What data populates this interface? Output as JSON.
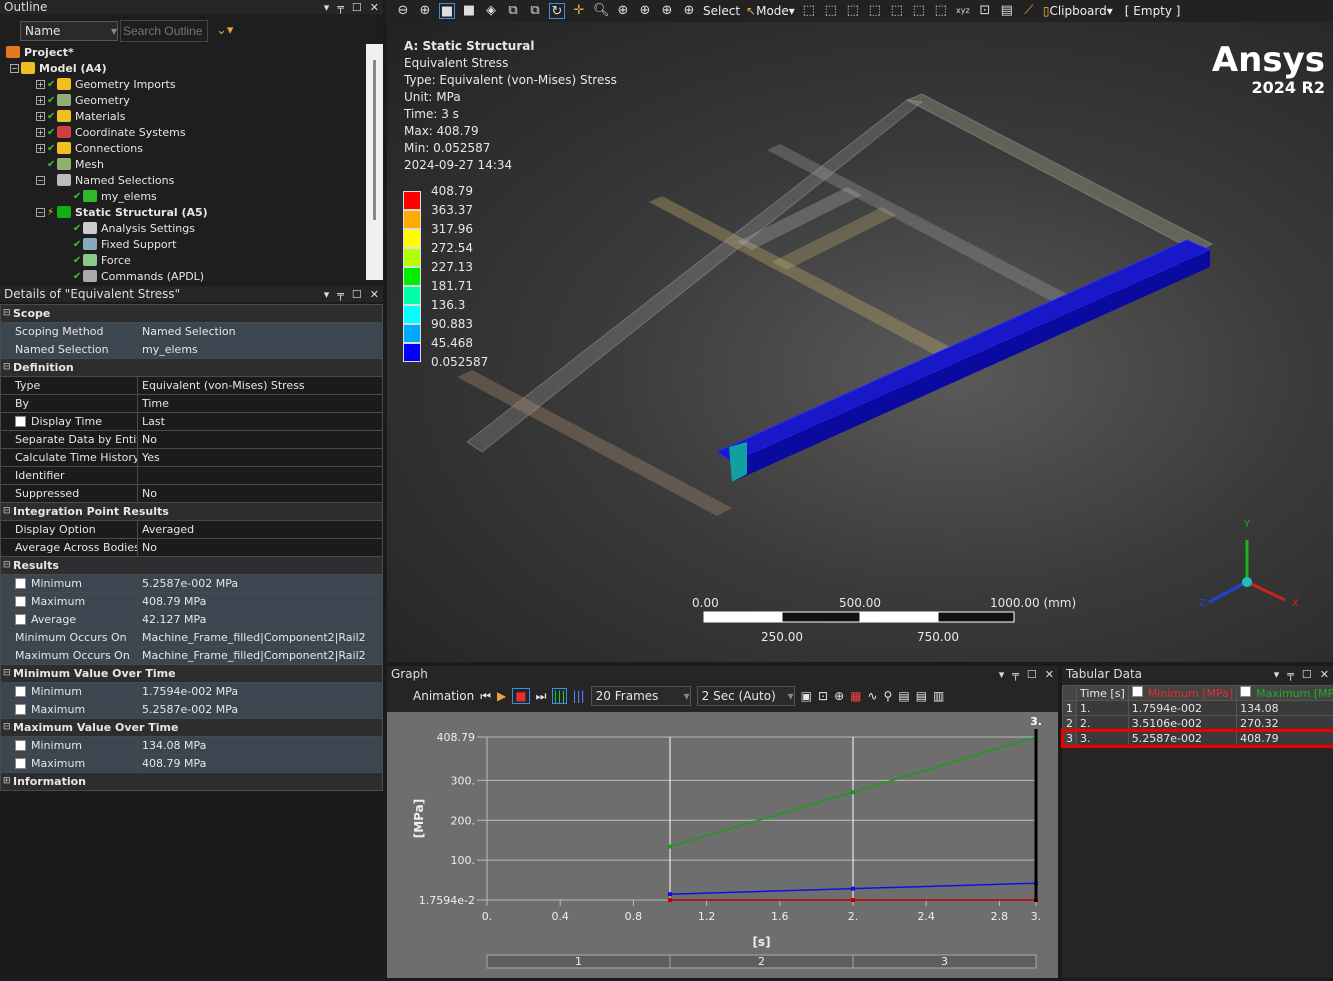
{
  "outline": {
    "title": "Outline",
    "filter_label": "Name",
    "search_placeholder": "Search Outline",
    "items": [
      {
        "label": "Project*",
        "level": 0,
        "bold": true,
        "icon": "project-icon",
        "color": "#e07b20"
      },
      {
        "label": "Model (A4)",
        "level": 1,
        "bold": true,
        "icon": "model-folder-icon",
        "color": "#f0c020",
        "exp": "-"
      },
      {
        "label": "Geometry Imports",
        "level": 2,
        "icon": "geometry-imports-icon",
        "color": "#f0c020",
        "exp": "+",
        "check": true
      },
      {
        "label": "Geometry",
        "level": 2,
        "icon": "geometry-icon",
        "color": "#8fae6f",
        "exp": "+",
        "check": true
      },
      {
        "label": "Materials",
        "level": 2,
        "icon": "materials-icon",
        "color": "#f0c020",
        "exp": "+",
        "check": true
      },
      {
        "label": "Coordinate Systems",
        "level": 2,
        "icon": "coordinate-systems-icon",
        "color": "#d04040",
        "exp": "+",
        "check": true
      },
      {
        "label": "Connections",
        "level": 2,
        "icon": "connections-icon",
        "color": "#f0c020",
        "exp": "+",
        "check": true
      },
      {
        "label": "Mesh",
        "level": 2,
        "icon": "mesh-icon",
        "color": "#8fae6f",
        "check": true
      },
      {
        "label": "Named Selections",
        "level": 2,
        "icon": "named-selections-icon",
        "color": "#bbb",
        "exp": "-"
      },
      {
        "label": "my_elems",
        "level": 3,
        "icon": "named-selection-item-icon",
        "color": "#2db82d",
        "check": true
      },
      {
        "label": "Static Structural (A5)",
        "level": 2,
        "bold": true,
        "icon": "static-structural-icon",
        "color": "#10b010",
        "exp": "-",
        "bolt": true
      },
      {
        "label": "Analysis Settings",
        "level": 3,
        "icon": "analysis-settings-icon",
        "color": "#ccc",
        "check": true
      },
      {
        "label": "Fixed Support",
        "level": 3,
        "icon": "fixed-support-icon",
        "color": "#8ab",
        "check": true
      },
      {
        "label": "Force",
        "level": 3,
        "icon": "force-icon",
        "color": "#8c8",
        "check": true
      },
      {
        "label": "Commands (APDL)",
        "level": 3,
        "icon": "commands-icon",
        "color": "#aaa",
        "check": true
      }
    ]
  },
  "details": {
    "title": "Details of \"Equivalent Stress\"",
    "rows": [
      {
        "g": "Scope"
      },
      {
        "k": "Scoping Method",
        "v": "Named Selection",
        "hl": true
      },
      {
        "k": "Named Selection",
        "v": "my_elems",
        "hl": true
      },
      {
        "g": "Definition"
      },
      {
        "k": "Type",
        "v": "Equivalent (von-Mises) Stress"
      },
      {
        "k": "By",
        "v": "Time"
      },
      {
        "k": "Display Time",
        "v": "Last",
        "cb": true
      },
      {
        "k": "Separate Data by Entity",
        "v": "No"
      },
      {
        "k": "Calculate Time History",
        "v": "Yes"
      },
      {
        "k": "Identifier",
        "v": ""
      },
      {
        "k": "Suppressed",
        "v": "No"
      },
      {
        "g": "Integration Point Results"
      },
      {
        "k": "Display Option",
        "v": "Averaged"
      },
      {
        "k": "Average Across Bodies",
        "v": "No"
      },
      {
        "g": "Results"
      },
      {
        "k": "Minimum",
        "v": "5.2587e-002 MPa",
        "cb": true,
        "hl": true
      },
      {
        "k": "Maximum",
        "v": "408.79 MPa",
        "cb": true,
        "hl": true
      },
      {
        "k": "Average",
        "v": "42.127 MPa",
        "cb": true,
        "hl": true
      },
      {
        "k": "Minimum Occurs On",
        "v": "Machine_Frame_filled|Component2|Rail2",
        "hl": true
      },
      {
        "k": "Maximum Occurs On",
        "v": "Machine_Frame_filled|Component2|Rail2",
        "hl": true
      },
      {
        "g": "Minimum Value Over Time"
      },
      {
        "k": "Minimum",
        "v": "1.7594e-002 MPa",
        "cb": true,
        "hl": true
      },
      {
        "k": "Maximum",
        "v": "5.2587e-002 MPa",
        "cb": true,
        "hl": true
      },
      {
        "g": "Maximum Value Over Time"
      },
      {
        "k": "Minimum",
        "v": "134.08 MPa",
        "cb": true,
        "hl": true
      },
      {
        "k": "Maximum",
        "v": "408.79 MPa",
        "cb": true,
        "hl": true
      },
      {
        "g": "Information",
        "collapsed": true
      }
    ]
  },
  "toolbar": {
    "select_label": "Select",
    "mode_label": "Mode",
    "clipboard_label": "Clipboard",
    "clipboard_value": "[ Empty ]"
  },
  "viewport": {
    "title": "A: Static Structural",
    "lines": [
      "Equivalent Stress",
      "Type: Equivalent (von-Mises) Stress",
      "Unit: MPa",
      "Time: 3 s",
      "Max: 408.79",
      "Min: 0.052587",
      "2024-09-27 14:34"
    ],
    "brand": "Ansys",
    "version": "2024 R2",
    "legend": [
      {
        "v": "408.79",
        "c": "#ff0000"
      },
      {
        "v": "363.37",
        "c": "#ffaa00"
      },
      {
        "v": "317.96",
        "c": "#ffff00"
      },
      {
        "v": "272.54",
        "c": "#b4ff00"
      },
      {
        "v": "227.13",
        "c": "#00ee00"
      },
      {
        "v": "181.71",
        "c": "#00ffaa"
      },
      {
        "v": "136.3",
        "c": "#00ffff"
      },
      {
        "v": "90.883",
        "c": "#00aaff"
      },
      {
        "v": "45.468",
        "c": "#0000ff"
      },
      {
        "v": "0.052587",
        "c": ""
      }
    ],
    "scale": {
      "top": [
        "0.00",
        "500.00",
        "1000.00 (mm)"
      ],
      "bottom": [
        "250.00",
        "750.00"
      ]
    },
    "axes": {
      "x": "X",
      "y": "Y",
      "z": "Z"
    }
  },
  "graph": {
    "title": "Graph",
    "animation_label": "Animation",
    "frames": "20 Frames",
    "duration": "2 Sec (Auto)"
  },
  "chart_data": {
    "type": "line",
    "xlabel": "[s]",
    "ylabel": "[MPa]",
    "xlim": [
      0,
      3
    ],
    "ylim": [
      0.017594,
      408.79
    ],
    "xticks": [
      "0.",
      "0.4",
      "0.8",
      "1.2",
      "1.6",
      "2.",
      "2.4",
      "2.8",
      "3."
    ],
    "yticks": [
      "408.79",
      "300.",
      "200.",
      "100.",
      "1.7594e-2"
    ],
    "current_time_label": "3.",
    "steps": [
      "1",
      "2",
      "3"
    ],
    "x": [
      1,
      2,
      3
    ],
    "series": [
      {
        "name": "Maximum [MPa]",
        "color": "#1a9a1a",
        "values": [
          134.08,
          270.32,
          408.79
        ]
      },
      {
        "name": "Minimum [MPa]",
        "color": "#c00000",
        "values": [
          0.017594,
          0.035106,
          0.052587
        ]
      },
      {
        "color": "#1010e0",
        "values": [
          14.5,
          28.5,
          42.127
        ]
      }
    ]
  },
  "tabular": {
    "title": "Tabular Data",
    "headers": [
      "Time [s]",
      "Minimum [MPa]",
      "Maximum [MPa]"
    ],
    "rows": [
      [
        "1",
        "1.",
        "1.7594e-002",
        "134.08"
      ],
      [
        "2",
        "2.",
        "3.5106e-002",
        "270.32"
      ],
      [
        "3",
        "3.",
        "5.2587e-002",
        "408.79"
      ]
    ],
    "selected_row": 3
  }
}
